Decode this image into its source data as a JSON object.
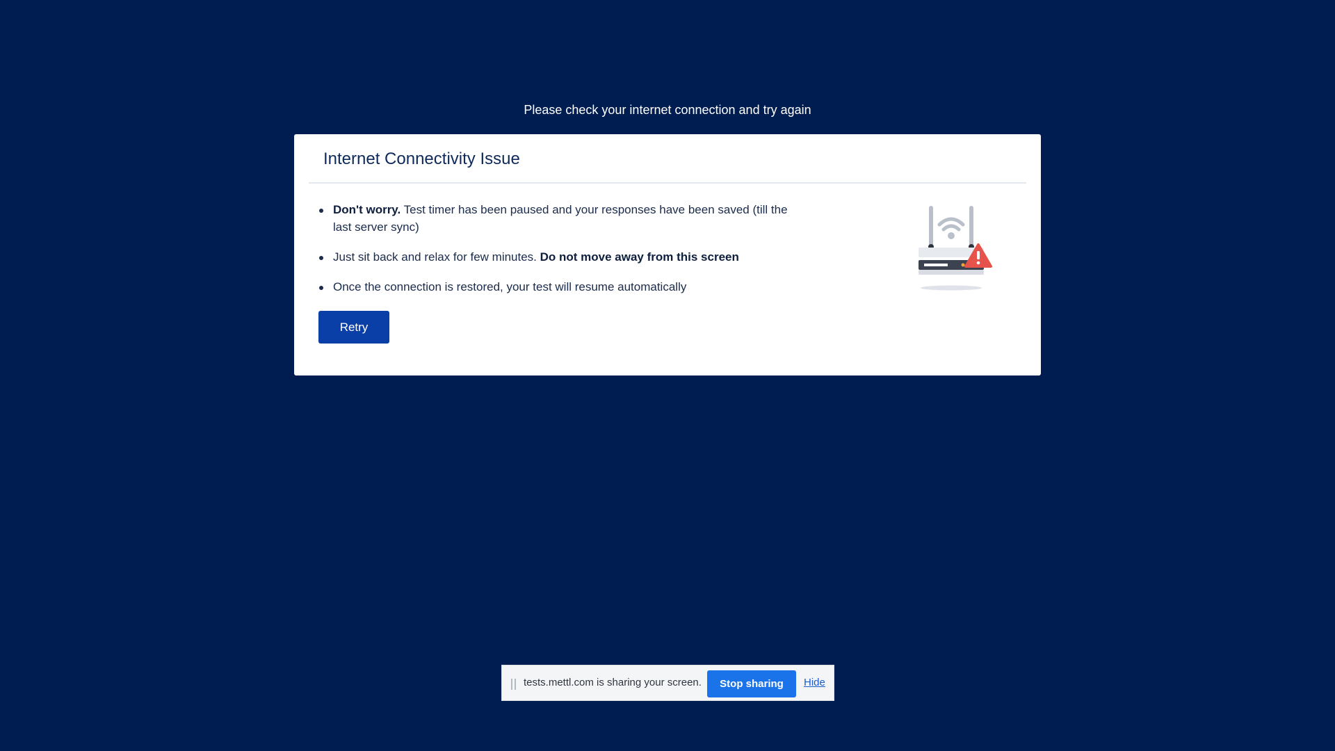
{
  "page": {
    "notice": "Please check your internet connection and try again"
  },
  "dialog": {
    "title": "Internet Connectivity Issue",
    "bullets": [
      {
        "bold": "Don't worry.",
        "text": " Test timer has been paused and your responses have been saved (till the last server sync)"
      },
      {
        "text": "Just sit back and relax for few minutes. ",
        "bold": "Do not move away from this screen"
      },
      {
        "text": "Once the connection is restored, your test will resume automatically"
      }
    ],
    "retry_label": "Retry",
    "illustration_icon": "router-warning-icon"
  },
  "share_bar": {
    "message": "tests.mettl.com is sharing your screen.",
    "stop_label": "Stop sharing",
    "hide_label": "Hide"
  },
  "colors": {
    "background": "#001d51",
    "button": "#0b3fa8",
    "stop_button": "#1a73e8",
    "warning": "#e5534b"
  }
}
